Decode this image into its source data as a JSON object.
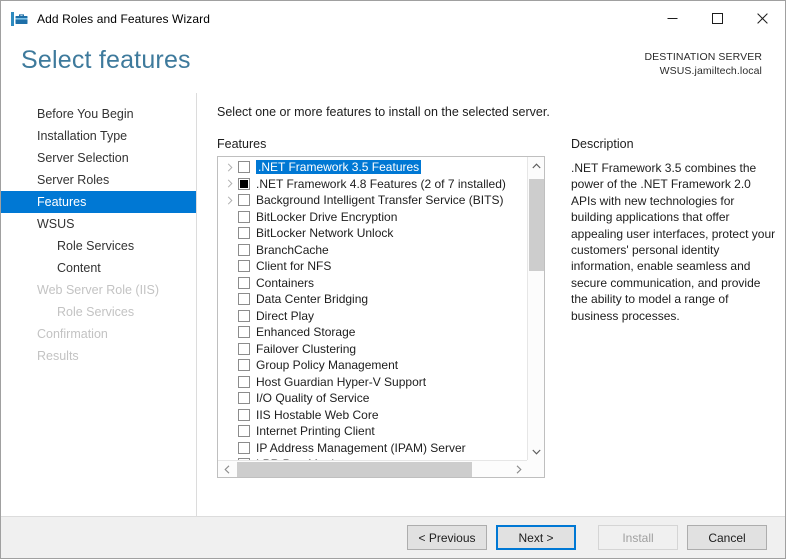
{
  "window": {
    "title": "Add Roles and Features Wizard",
    "icon": "roles-features-wizard-icon",
    "controls": {
      "minimize": "minimize-icon",
      "maximize": "maximize-icon",
      "close": "close-icon"
    }
  },
  "header": {
    "page_title": "Select features",
    "destination_label": "DESTINATION SERVER",
    "destination_server": "WSUS.jamiltech.local",
    "accent_color": "#3e7a9c"
  },
  "sidebar": {
    "selected_color": "#0078d4",
    "items": [
      {
        "label": "Before You Begin",
        "state": "enabled",
        "indent": false
      },
      {
        "label": "Installation Type",
        "state": "enabled",
        "indent": false
      },
      {
        "label": "Server Selection",
        "state": "enabled",
        "indent": false
      },
      {
        "label": "Server Roles",
        "state": "enabled",
        "indent": false
      },
      {
        "label": "Features",
        "state": "selected",
        "indent": false
      },
      {
        "label": "WSUS",
        "state": "enabled",
        "indent": false
      },
      {
        "label": "Role Services",
        "state": "enabled",
        "indent": true
      },
      {
        "label": "Content",
        "state": "enabled",
        "indent": true
      },
      {
        "label": "Web Server Role (IIS)",
        "state": "disabled",
        "indent": false
      },
      {
        "label": "Role Services",
        "state": "disabled",
        "indent": true
      },
      {
        "label": "Confirmation",
        "state": "disabled",
        "indent": false
      },
      {
        "label": "Results",
        "state": "disabled",
        "indent": false
      }
    ]
  },
  "main": {
    "instruction": "Select one or more features to install on the selected server.",
    "features_label": "Features",
    "description_label": "Description",
    "description_text": ".NET Framework 3.5 combines the power of the .NET Framework 2.0 APIs with new technologies for building applications that offer appealing user interfaces, protect your customers' personal identity information, enable seamless and secure communication, and provide the ability to model a range of business processes.",
    "features": [
      {
        "label": ".NET Framework 3.5 Features",
        "checkbox": "unchecked",
        "expandable": true,
        "selected": true
      },
      {
        "label": ".NET Framework 4.8 Features (2 of 7 installed)",
        "checkbox": "partial",
        "expandable": true,
        "selected": false
      },
      {
        "label": "Background Intelligent Transfer Service (BITS)",
        "checkbox": "unchecked",
        "expandable": true,
        "selected": false
      },
      {
        "label": "BitLocker Drive Encryption",
        "checkbox": "unchecked",
        "expandable": false,
        "selected": false
      },
      {
        "label": "BitLocker Network Unlock",
        "checkbox": "unchecked",
        "expandable": false,
        "selected": false
      },
      {
        "label": "BranchCache",
        "checkbox": "unchecked",
        "expandable": false,
        "selected": false
      },
      {
        "label": "Client for NFS",
        "checkbox": "unchecked",
        "expandable": false,
        "selected": false
      },
      {
        "label": "Containers",
        "checkbox": "unchecked",
        "expandable": false,
        "selected": false
      },
      {
        "label": "Data Center Bridging",
        "checkbox": "unchecked",
        "expandable": false,
        "selected": false
      },
      {
        "label": "Direct Play",
        "checkbox": "unchecked",
        "expandable": false,
        "selected": false
      },
      {
        "label": "Enhanced Storage",
        "checkbox": "unchecked",
        "expandable": false,
        "selected": false
      },
      {
        "label": "Failover Clustering",
        "checkbox": "unchecked",
        "expandable": false,
        "selected": false
      },
      {
        "label": "Group Policy Management",
        "checkbox": "unchecked",
        "expandable": false,
        "selected": false
      },
      {
        "label": "Host Guardian Hyper-V Support",
        "checkbox": "unchecked",
        "expandable": false,
        "selected": false
      },
      {
        "label": "I/O Quality of Service",
        "checkbox": "unchecked",
        "expandable": false,
        "selected": false
      },
      {
        "label": "IIS Hostable Web Core",
        "checkbox": "unchecked",
        "expandable": false,
        "selected": false
      },
      {
        "label": "Internet Printing Client",
        "checkbox": "unchecked",
        "expandable": false,
        "selected": false
      },
      {
        "label": "IP Address Management (IPAM) Server",
        "checkbox": "unchecked",
        "expandable": false,
        "selected": false
      },
      {
        "label": "LPR Port Monitor",
        "checkbox": "unchecked",
        "expandable": false,
        "selected": false
      }
    ]
  },
  "footer": {
    "previous_label": "< Previous",
    "next_label": "Next >",
    "install_label": "Install",
    "cancel_label": "Cancel",
    "next_focused": true,
    "install_disabled": true
  }
}
